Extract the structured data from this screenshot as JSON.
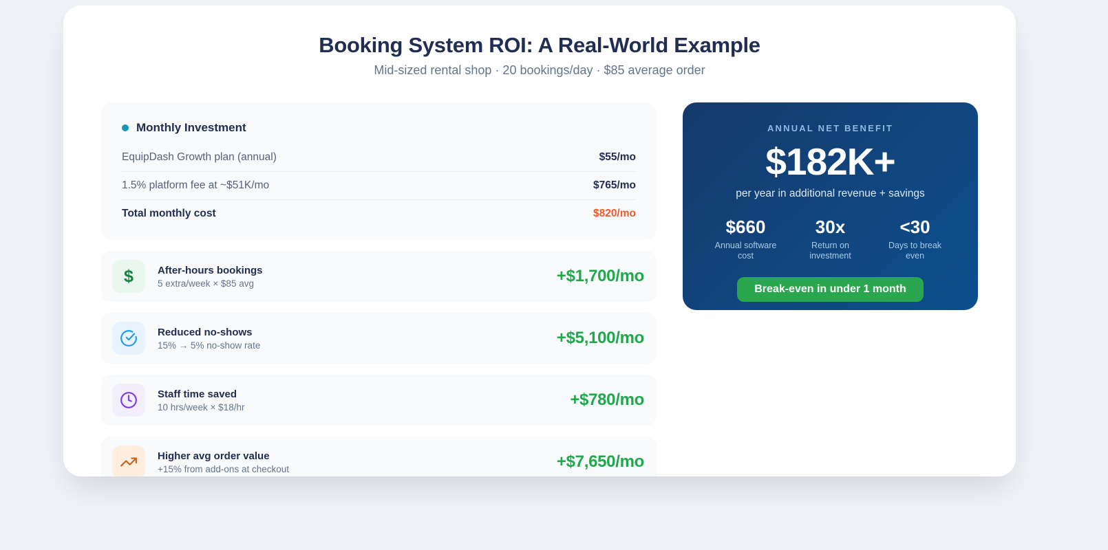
{
  "page": {
    "title": "Booking System ROI: A Real-World Example",
    "subtitle": "Mid-sized rental shop · 20 bookings/day · $85 average order"
  },
  "investment": {
    "header": "Monthly Investment",
    "rows": [
      {
        "label": "EquipDash Growth plan (annual)",
        "value": "$55/mo"
      },
      {
        "label": "1.5% platform fee at ~$51K/mo",
        "value": "$765/mo"
      }
    ],
    "total": {
      "label": "Total monthly cost",
      "value": "$820/mo"
    }
  },
  "benefits": [
    {
      "icon": "dollar-icon",
      "glyph": "$",
      "title": "After-hours bookings",
      "detail": "5 extra/week × $85 avg",
      "value": "+$1,700/mo"
    },
    {
      "icon": "check-circle-icon",
      "title": "Reduced no-shows",
      "detail": "15% → 5% no-show rate",
      "value": "+$5,100/mo"
    },
    {
      "icon": "clock-icon",
      "title": "Staff time saved",
      "detail": "10 hrs/week × $18/hr",
      "value": "+$780/mo"
    },
    {
      "icon": "trending-up-icon",
      "title": "Higher avg order value",
      "detail": "+15% from add-ons at checkout",
      "value": "+$7,650/mo"
    }
  ],
  "summary": {
    "label": "ANNUAL NET BENEFIT",
    "headline": "$182K+",
    "subtext": "per year in additional revenue + savings",
    "stats": [
      {
        "value": "$660",
        "label": "Annual software cost"
      },
      {
        "value": "30x",
        "label": "Return on investment"
      },
      {
        "value": "<30",
        "label": "Days to break even"
      }
    ],
    "badge": "Break-even in under 1 month"
  },
  "colors": {
    "accent_orange": "#f1582a",
    "accent_green": "#1fa84c",
    "badge_green": "#2aa64f",
    "panel_navy_start": "#153a6b",
    "panel_navy_end": "#0c4f8e",
    "teal_dot": "#1596ba"
  }
}
